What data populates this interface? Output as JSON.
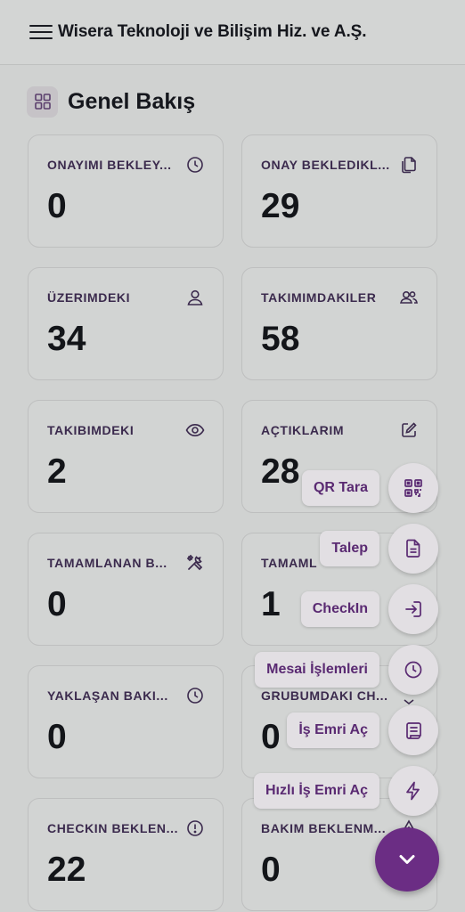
{
  "header": {
    "company": "Wisera Teknoloji ve Bilişim Hiz. ve A.Ş."
  },
  "section": {
    "title": "Genel Bakış"
  },
  "cards": [
    {
      "label": "ONAYIMI BEKLEY...",
      "value": "0",
      "icon": "clock-icon"
    },
    {
      "label": "ONAY BEKLEDIKL...",
      "value": "29",
      "icon": "documents-icon"
    },
    {
      "label": "ÜZERIMDEKI",
      "value": "34",
      "icon": "user-icon"
    },
    {
      "label": "TAKIMIMDAKILER",
      "value": "58",
      "icon": "users-icon"
    },
    {
      "label": "TAKIBIMDEKI",
      "value": "2",
      "icon": "eye-icon"
    },
    {
      "label": "AÇTIKLARIM",
      "value": "28",
      "icon": "edit-icon"
    },
    {
      "label": "TAMAMLANAN B...",
      "value": "0",
      "icon": "tools-icon"
    },
    {
      "label": "TAMAML",
      "value": "1",
      "icon": ""
    },
    {
      "label": "YAKLAŞAN BAKI...",
      "value": "0",
      "icon": "clock-icon"
    },
    {
      "label": "GRUBUMDAKI CH...",
      "value": "0",
      "icon": "chevron-icon"
    },
    {
      "label": "CHECKIN BEKLEN...",
      "value": "22",
      "icon": "alert-circle-icon"
    },
    {
      "label": "BAKIM BEKLENM...",
      "value": "0",
      "icon": "warning-icon"
    }
  ],
  "fab_actions": [
    {
      "label": "QR Tara",
      "icon": "qr-icon"
    },
    {
      "label": "Talep",
      "icon": "document-icon"
    },
    {
      "label": "CheckIn",
      "icon": "login-icon"
    },
    {
      "label": "Mesai İşlemleri",
      "icon": "clock-icon"
    },
    {
      "label": "İş Emri Aç",
      "icon": "scroll-icon"
    },
    {
      "label": "Hızlı İş Emri Aç",
      "icon": "bolt-icon"
    }
  ],
  "colors": {
    "accent": "#6b2d84",
    "label": "#3b2a4d",
    "fab_text": "#5a2a72"
  }
}
